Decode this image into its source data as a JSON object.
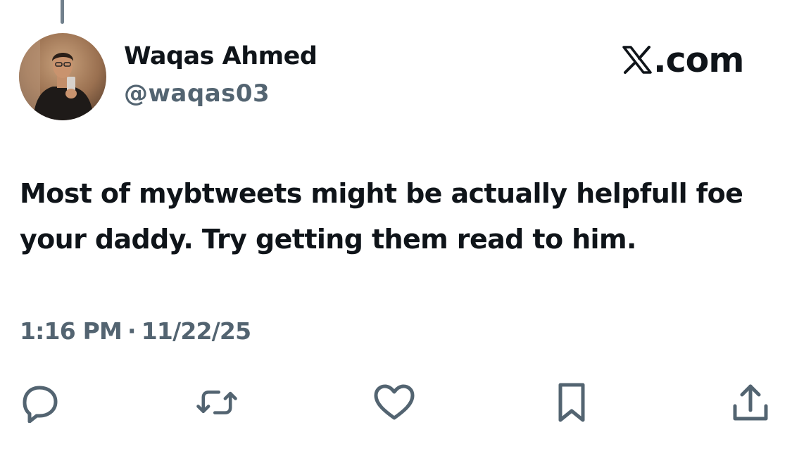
{
  "tweet": {
    "author_name": "Waqas Ahmed",
    "author_handle": "@waqas03",
    "text": "Most of mybtweets might be actually helpfull foe your daddy. Try getting them read to him.",
    "time": "1:16 PM",
    "separator": "·",
    "date": "11/22/25"
  },
  "brand": {
    "text": ".com",
    "logo_icon": "x-logo-icon"
  },
  "actions": [
    {
      "name": "reply",
      "icon": "reply-icon"
    },
    {
      "name": "repost",
      "icon": "repost-icon"
    },
    {
      "name": "like",
      "icon": "heart-icon"
    },
    {
      "name": "bookmark",
      "icon": "bookmark-icon"
    },
    {
      "name": "share",
      "icon": "share-icon"
    }
  ],
  "colors": {
    "primary_text": "#0f1419",
    "secondary_text": "#536471",
    "background": "#ffffff"
  }
}
